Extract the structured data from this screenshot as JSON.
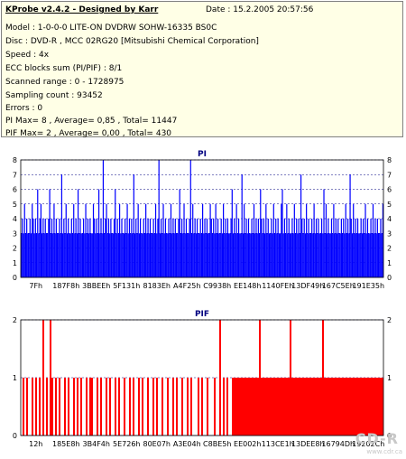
{
  "info": {
    "title": "KProbe v2.4.2 - Designed by Karr",
    "date": "Date : 15.2.2005 20:57:56",
    "lines": [
      "Model : 1-0-0-0 LITE-ON DVDRW SOHW-16335 BS0C",
      "Disc : DVD-R , MCC 02RG20  [Mitsubishi Chemical Corporation]",
      "Speed : 4x",
      "ECC blocks sum (PI/PIF) : 8/1",
      "Scanned range : 0 - 1728975",
      "Sampling count : 93452",
      "Errors : 0",
      "PI Max= 8 , Average= 0,85 , Total= 11447",
      "PIF Max= 2 , Average= 0,00 , Total= 430"
    ]
  },
  "colors": {
    "pi": "#0000ff",
    "pif": "#ff0000",
    "grid": "#000080",
    "title": "#000080"
  },
  "watermark": {
    "text": "CD-R",
    "sub": "www.cdr.ca"
  },
  "chart_data": [
    {
      "type": "bar",
      "title": "PI",
      "ylim": [
        0,
        8
      ],
      "yticks": [
        "0",
        "1",
        "2",
        "3",
        "4",
        "5",
        "6",
        "7",
        "8"
      ],
      "xticks": [
        "7Fh",
        "187F8h",
        "3BBEEh",
        "5F131h",
        "8183Eh",
        "A4F25h",
        "C9938h",
        "EE148h",
        "1140FEh",
        "13DF49h",
        "167C5Eh",
        "191E35h"
      ],
      "series": [
        {
          "values": [
            3,
            4,
            3,
            5,
            3,
            4,
            3,
            3,
            4,
            3,
            5,
            4,
            3,
            4,
            3,
            6,
            3,
            4,
            5,
            3,
            4,
            3,
            4,
            3,
            3,
            4,
            6,
            3,
            4,
            3,
            5,
            3,
            4,
            3,
            3,
            4,
            3,
            7,
            3,
            4,
            3,
            5,
            3,
            4,
            3,
            3,
            4,
            3,
            5,
            3,
            4,
            3,
            6,
            3,
            4,
            3,
            3,
            4,
            3,
            5,
            3,
            4,
            3,
            4,
            3,
            3,
            5,
            4,
            3,
            4,
            3,
            6,
            3,
            4,
            3,
            8,
            3,
            4,
            5,
            3,
            4,
            3,
            4,
            3,
            3,
            4,
            6,
            3,
            4,
            3,
            5,
            3,
            4,
            3,
            3,
            4,
            3,
            5,
            3,
            4,
            3,
            4,
            3,
            7,
            3,
            4,
            3,
            5,
            3,
            4,
            3,
            3,
            4,
            3,
            5,
            3,
            4,
            3,
            4,
            3,
            3,
            4,
            3,
            5,
            3,
            4,
            8,
            3,
            4,
            3,
            5,
            3,
            4,
            3,
            3,
            4,
            3,
            5,
            3,
            4,
            3,
            4,
            3,
            3,
            4,
            6,
            3,
            4,
            3,
            5,
            3,
            4,
            3,
            3,
            4,
            8,
            3,
            5,
            3,
            4,
            3,
            4,
            3,
            3,
            4,
            3,
            5,
            3,
            4,
            3,
            4,
            3,
            3,
            5,
            4,
            3,
            4,
            3,
            5,
            3,
            4,
            3,
            3,
            4,
            3,
            5,
            3,
            4,
            3,
            4,
            3,
            3,
            4,
            6,
            3,
            4,
            3,
            5,
            3,
            4,
            3,
            3,
            7,
            3,
            5,
            3,
            4,
            3,
            4,
            3,
            3,
            4,
            3,
            5,
            3,
            4,
            3,
            4,
            3,
            6,
            4,
            3,
            4,
            3,
            5,
            3,
            4,
            3,
            3,
            4,
            3,
            5,
            3,
            4,
            3,
            4,
            3,
            3,
            5,
            6,
            3,
            4,
            3,
            5,
            3,
            4,
            3,
            3,
            4,
            3,
            5,
            3,
            4,
            3,
            4,
            3,
            7,
            4,
            3,
            4,
            3,
            5,
            3,
            4,
            3,
            3,
            4,
            3,
            5,
            3,
            4,
            3,
            4,
            3,
            3,
            4,
            3,
            6,
            3,
            5,
            3,
            4,
            3,
            3,
            4,
            3,
            5,
            3,
            4,
            3,
            4,
            3,
            3,
            4,
            3,
            4,
            3,
            5,
            3,
            4,
            3,
            7,
            4,
            3,
            5,
            3,
            4,
            3,
            4,
            3,
            3,
            4,
            3,
            4,
            3,
            5,
            3,
            4,
            3,
            3,
            4,
            3,
            5,
            3,
            4,
            3,
            4,
            3,
            3,
            4,
            3,
            5
          ]
        }
      ]
    },
    {
      "type": "bar",
      "title": "PIF",
      "ylim": [
        0,
        2
      ],
      "yticks": [
        "0",
        "1",
        "2"
      ],
      "xticks": [
        "12h",
        "185E8h",
        "3B4F4h",
        "5E726h",
        "80E07h",
        "A3E04h",
        "C8BE5h",
        "EE002h",
        "113CE1h",
        "13DEE8h",
        "16794Dh",
        "19202Ch"
      ],
      "series": [
        {
          "values": [
            0,
            1,
            0,
            1,
            0,
            0,
            1,
            0,
            1,
            0,
            1,
            0,
            2,
            0,
            1,
            0,
            2,
            1,
            0,
            1,
            0,
            1,
            0,
            0,
            1,
            0,
            1,
            0,
            0,
            1,
            0,
            1,
            0,
            1,
            0,
            0,
            1,
            0,
            1,
            1,
            0,
            0,
            1,
            0,
            1,
            0,
            0,
            1,
            0,
            1,
            0,
            0,
            1,
            0,
            1,
            0,
            0,
            1,
            0,
            0,
            1,
            0,
            1,
            0,
            0,
            1,
            0,
            1,
            0,
            0,
            1,
            0,
            0,
            1,
            0,
            1,
            0,
            0,
            1,
            0,
            0,
            1,
            0,
            0,
            1,
            0,
            1,
            0,
            0,
            1,
            0,
            0,
            1,
            0,
            1,
            0,
            0,
            0,
            1,
            0,
            1,
            0,
            0,
            1,
            0,
            0,
            0,
            1,
            0,
            0,
            2,
            0,
            1,
            0,
            1,
            0,
            0,
            1,
            1,
            1,
            1,
            1,
            1,
            1,
            1,
            1,
            1,
            1,
            1,
            1,
            1,
            1,
            2,
            1,
            1,
            1,
            1,
            1,
            1,
            1,
            1,
            1,
            1,
            1,
            1,
            1,
            1,
            1,
            1,
            2,
            1,
            1,
            1,
            1,
            1,
            1,
            1,
            1,
            1,
            1,
            1,
            1,
            1,
            1,
            1,
            1,
            1,
            2,
            1,
            1,
            1,
            1,
            1,
            1,
            1,
            1,
            1,
            1,
            1,
            1,
            1,
            1,
            1,
            1,
            1,
            1,
            1,
            1,
            1,
            1,
            1,
            1,
            1,
            1,
            1,
            1,
            1,
            1,
            1,
            1,
            1
          ]
        }
      ]
    }
  ]
}
